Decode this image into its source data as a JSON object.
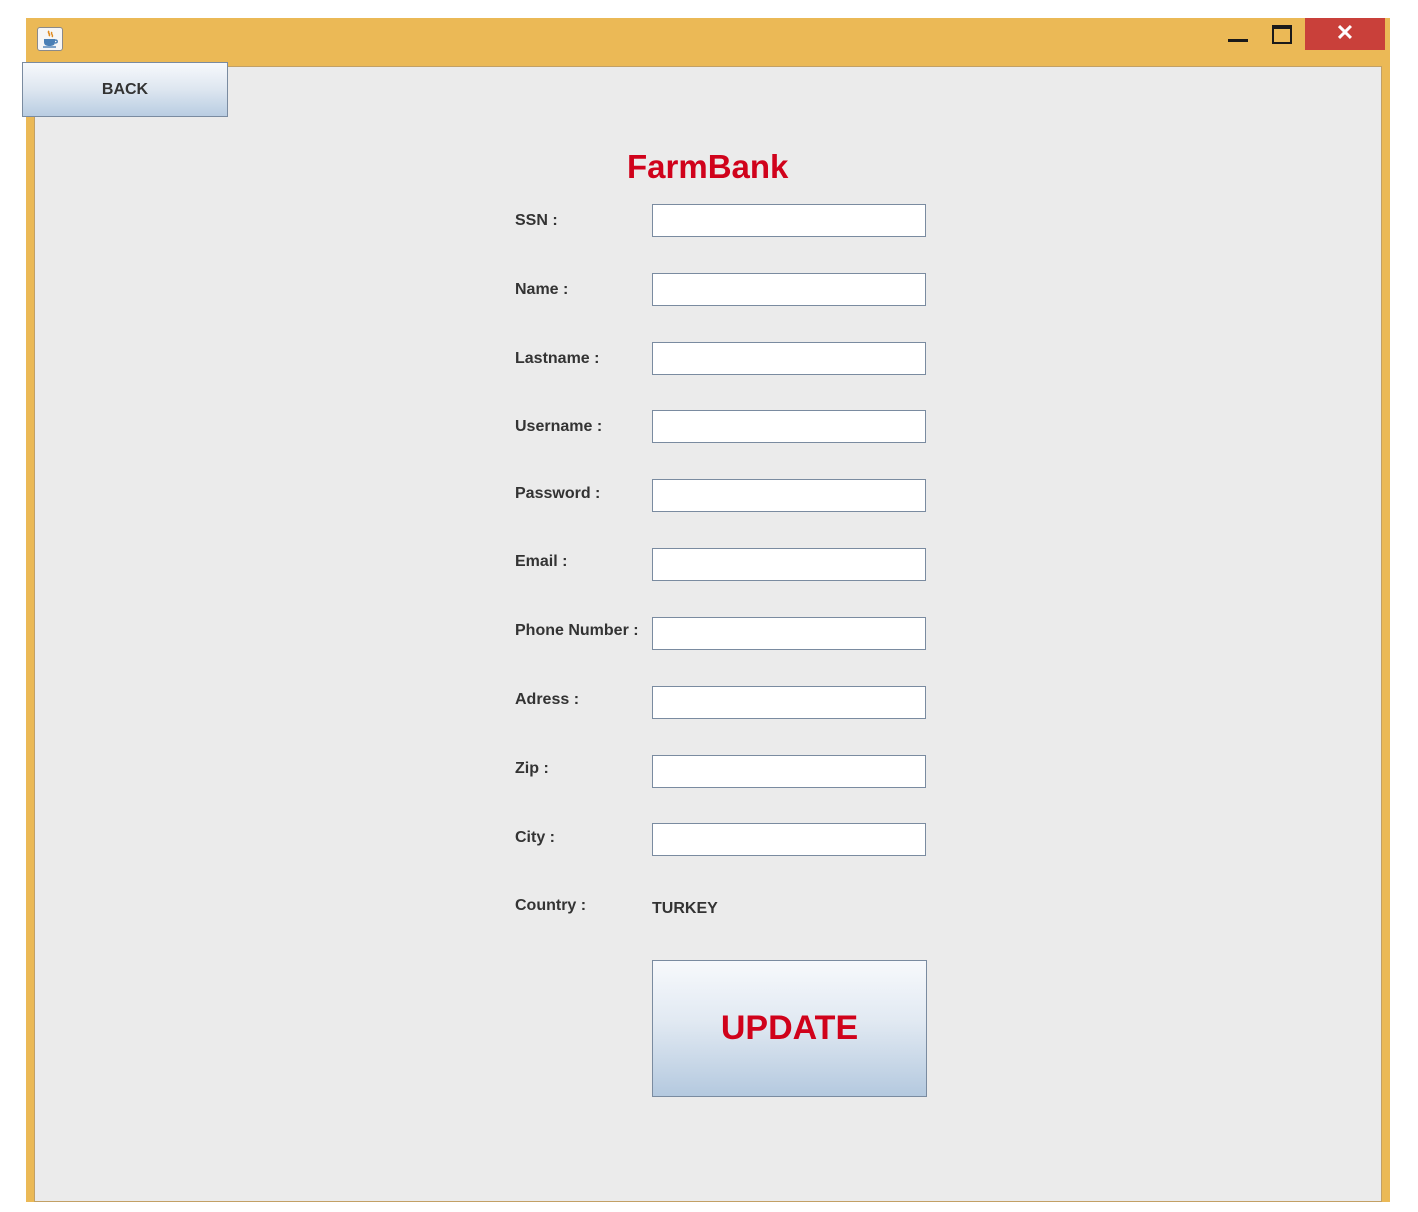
{
  "window": {
    "controls": {
      "close": "✕"
    }
  },
  "toolbar": {
    "back_label": "BACK"
  },
  "form": {
    "title": "FarmBank",
    "fields": [
      {
        "label": "SSN :",
        "value": ""
      },
      {
        "label": "Name :",
        "value": ""
      },
      {
        "label": "Lastname :",
        "value": ""
      },
      {
        "label": "Username :",
        "value": ""
      },
      {
        "label": "Password :",
        "value": ""
      },
      {
        "label": "Email :",
        "value": ""
      },
      {
        "label": "Phone Number :",
        "value": ""
      },
      {
        "label": "Adress :",
        "value": ""
      },
      {
        "label": "Zip :",
        "value": ""
      },
      {
        "label": "City :",
        "value": ""
      }
    ],
    "country": {
      "label": "Country :",
      "value": "TURKEY"
    },
    "update_label": "UPDATE"
  },
  "colors": {
    "title_bar": "#ebb956",
    "accent_text": "#d0021b",
    "close_button": "#c9403a"
  },
  "icons": {
    "app": "java-cup-icon",
    "minimize": "minimize-icon",
    "maximize": "maximize-icon",
    "close": "close-icon"
  }
}
